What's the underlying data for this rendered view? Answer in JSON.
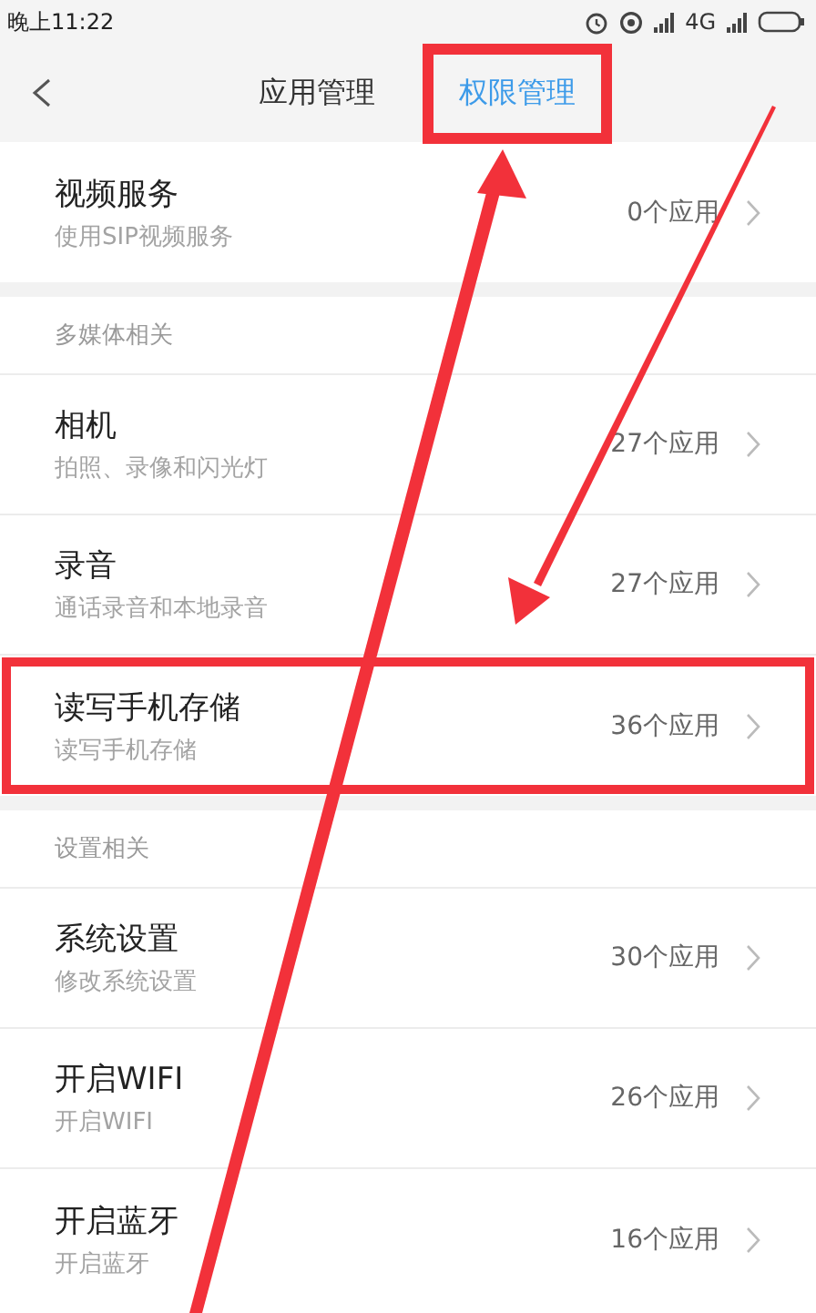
{
  "status_bar": {
    "time": "晚上11:22",
    "network": "4G"
  },
  "header": {
    "tabs": [
      {
        "label": "应用管理",
        "selected": false,
        "highlighted": false
      },
      {
        "label": "权限管理",
        "selected": true,
        "highlighted": true
      }
    ]
  },
  "sections": [
    {
      "items": [
        {
          "title": "视频服务",
          "subtitle": "使用SIP视频服务",
          "count": "0个应用",
          "highlighted": false
        }
      ]
    },
    {
      "heading": "多媒体相关",
      "items": [
        {
          "title": "相机",
          "subtitle": "拍照、录像和闪光灯",
          "count": "27个应用",
          "highlighted": false
        },
        {
          "title": "录音",
          "subtitle": "通话录音和本地录音",
          "count": "27个应用",
          "highlighted": false
        },
        {
          "title": "读写手机存储",
          "subtitle": "读写手机存储",
          "count": "36个应用",
          "highlighted": true
        }
      ]
    },
    {
      "heading": "设置相关",
      "items": [
        {
          "title": "系统设置",
          "subtitle": "修改系统设置",
          "count": "30个应用",
          "highlighted": false
        },
        {
          "title": "开启WIFI",
          "subtitle": "开启WIFI",
          "count": "26个应用",
          "highlighted": false
        },
        {
          "title": "开启蓝牙",
          "subtitle": "开启蓝牙",
          "count": "16个应用",
          "highlighted": false
        }
      ]
    }
  ]
}
